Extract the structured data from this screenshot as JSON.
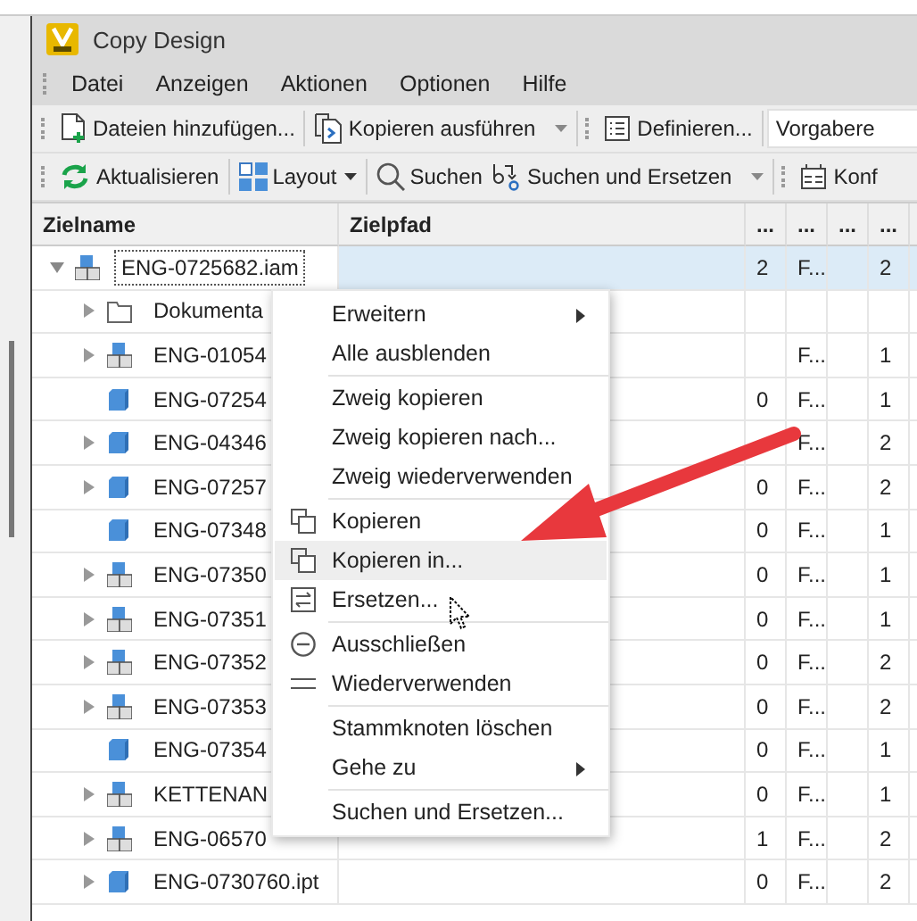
{
  "window": {
    "title": "Copy Design"
  },
  "menu_bar": [
    "Datei",
    "Anzeigen",
    "Aktionen",
    "Optionen",
    "Hilfe"
  ],
  "toolbars": [
    [
      {
        "kind": "grip"
      },
      {
        "kind": "add",
        "label": "Dateien hinzufügen...",
        "dropdown": false
      },
      {
        "kind": "separator"
      },
      {
        "kind": "run",
        "label": "Kopieren ausführen",
        "dropdown": true
      },
      {
        "kind": "separator"
      },
      {
        "kind": "grip"
      },
      {
        "kind": "define",
        "label": "Definieren...",
        "dropdown": false
      },
      {
        "kind": "separator"
      },
      {
        "kind": "combo",
        "value": "Vorgabere"
      }
    ],
    [
      {
        "kind": "grip"
      },
      {
        "kind": "refresh",
        "label": "Aktualisieren",
        "dropdown": false
      },
      {
        "kind": "separator"
      },
      {
        "kind": "layout",
        "label": "Layout",
        "dropdown": true
      },
      {
        "kind": "separator"
      },
      {
        "kind": "search",
        "label": "Suchen",
        "dropdown": false
      },
      {
        "kind": "replace",
        "label": "Suchen und Ersetzen",
        "dropdown": true
      },
      {
        "kind": "separator"
      },
      {
        "kind": "grip"
      },
      {
        "kind": "config",
        "label": "Konf",
        "dropdown": false
      }
    ]
  ],
  "table": {
    "columns": [
      "Zielname",
      "Zielpfad",
      "...",
      "...",
      "...",
      "..."
    ],
    "rows": [
      {
        "kind": "assembly",
        "expanded": true,
        "selected": true,
        "cells": [
          "ENG-0725682.iam",
          "",
          "2",
          "F...",
          "",
          "2"
        ],
        "children": [
          {
            "kind": "folder",
            "expanded": false,
            "selected": false,
            "cells": [
              "Dokumenta",
              "",
              "",
              "",
              "",
              ""
            ]
          },
          {
            "kind": "assembly",
            "expanded": false,
            "selected": false,
            "cells": [
              "ENG-01054",
              "",
              "",
              "F...",
              "",
              "1"
            ]
          },
          {
            "kind": "part",
            "selected": false,
            "cells": [
              "ENG-07254",
              "",
              "0",
              "F...",
              "",
              "1"
            ]
          },
          {
            "kind": "part",
            "expanded": false,
            "selected": false,
            "cells": [
              "ENG-04346",
              "",
              "",
              "F...",
              "",
              "2"
            ]
          },
          {
            "kind": "part",
            "expanded": false,
            "selected": false,
            "cells": [
              "ENG-07257",
              "",
              "0",
              "F...",
              "",
              "2"
            ]
          },
          {
            "kind": "part",
            "selected": false,
            "cells": [
              "ENG-07348",
              "",
              "0",
              "F...",
              "",
              "1"
            ]
          },
          {
            "kind": "assembly",
            "expanded": false,
            "selected": false,
            "cells": [
              "ENG-07350",
              "",
              "0",
              "F...",
              "",
              "1"
            ]
          },
          {
            "kind": "assembly",
            "expanded": false,
            "selected": false,
            "cells": [
              "ENG-07351",
              "",
              "0",
              "F...",
              "",
              "1"
            ]
          },
          {
            "kind": "assembly",
            "expanded": false,
            "selected": false,
            "cells": [
              "ENG-07352",
              "",
              "0",
              "F...",
              "",
              "2"
            ]
          },
          {
            "kind": "assembly",
            "expanded": false,
            "selected": false,
            "cells": [
              "ENG-07353",
              "",
              "0",
              "F...",
              "",
              "2"
            ]
          },
          {
            "kind": "part",
            "selected": false,
            "cells": [
              "ENG-07354",
              "",
              "0",
              "F...",
              "",
              "1"
            ]
          },
          {
            "kind": "assembly",
            "expanded": false,
            "selected": false,
            "cells": [
              "KETTENAN",
              "",
              "0",
              "F...",
              "",
              "1"
            ]
          },
          {
            "kind": "assembly",
            "expanded": false,
            "selected": false,
            "cells": [
              "ENG-06570",
              "",
              "1",
              "F...",
              "",
              "2"
            ]
          },
          {
            "kind": "part",
            "expanded": false,
            "selected": false,
            "cells": [
              "ENG-0730760.ipt",
              "",
              "0",
              "F...",
              "",
              "2"
            ]
          }
        ]
      }
    ]
  },
  "context_menu": {
    "items": [
      {
        "kind": "plain",
        "label": "Erweitern",
        "submenu": true,
        "highlighted": false
      },
      {
        "kind": "plain",
        "label": "Alle ausblenden",
        "submenu": false,
        "highlighted": false
      },
      {
        "kind": "separator"
      },
      {
        "kind": "plain",
        "label": "Zweig kopieren",
        "submenu": false,
        "highlighted": false
      },
      {
        "kind": "plain",
        "label": "Zweig kopieren nach...",
        "submenu": false,
        "highlighted": false
      },
      {
        "kind": "plain",
        "label": "Zweig wiederverwenden",
        "submenu": false,
        "highlighted": false
      },
      {
        "kind": "separator"
      },
      {
        "kind": "copy",
        "label": "Kopieren",
        "submenu": false,
        "highlighted": false
      },
      {
        "kind": "copy",
        "label": "Kopieren in...",
        "submenu": false,
        "highlighted": true
      },
      {
        "kind": "replace",
        "label": "Ersetzen...",
        "submenu": false,
        "highlighted": false
      },
      {
        "kind": "separator"
      },
      {
        "kind": "exclude",
        "label": "Ausschließen",
        "submenu": false,
        "highlighted": false
      },
      {
        "kind": "reuse",
        "label": "Wiederverwenden",
        "submenu": false,
        "highlighted": false
      },
      {
        "kind": "separator"
      },
      {
        "kind": "plain",
        "label": "Stammknoten löschen",
        "submenu": false,
        "highlighted": false
      },
      {
        "kind": "plain",
        "label": "Gehe zu",
        "submenu": true,
        "highlighted": false
      },
      {
        "kind": "separator"
      },
      {
        "kind": "plain",
        "label": "Suchen und Ersetzen...",
        "submenu": false,
        "highlighted": false
      }
    ]
  }
}
